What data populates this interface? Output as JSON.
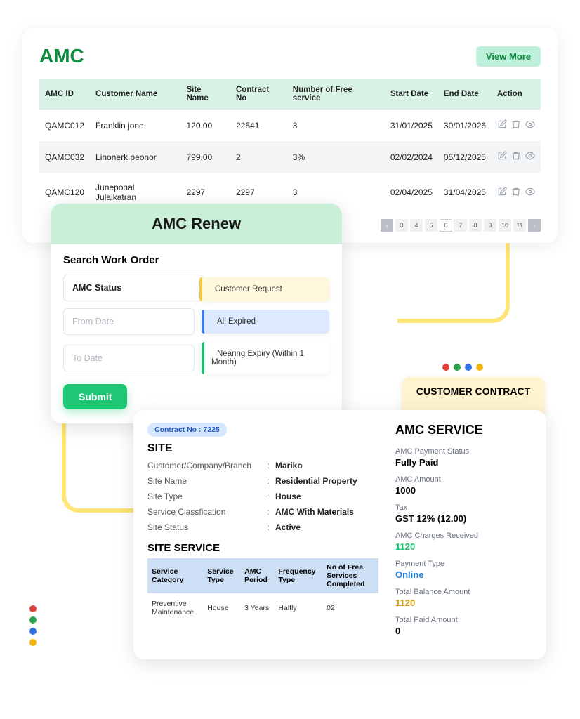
{
  "amc": {
    "title": "AMC",
    "view_more": "View More",
    "headers": [
      "AMC ID",
      "Customer Name",
      "Site Name",
      "Contract No",
      "Number of Free service",
      "Start Date",
      "End Date",
      "Action"
    ],
    "rows": [
      {
        "id": "QAMC012",
        "customer": "Franklin jone",
        "site": "120.00",
        "contract": "22541",
        "free": "3",
        "start": "31/01/2025",
        "end": "30/01/2026"
      },
      {
        "id": "QAMC032",
        "customer": "Linonerk peonor",
        "site": "799.00",
        "contract": "2",
        "free": "3%",
        "start": "02/02/2024",
        "end": "05/12/2025"
      },
      {
        "id": "QAMC120",
        "customer": "Juneponal Julaikatran",
        "site": "2297",
        "contract": "2297",
        "free": "3",
        "start": "02/04/2025",
        "end": "31/04/2025"
      }
    ],
    "pages": [
      "3",
      "4",
      "5",
      "6",
      "7",
      "8",
      "9",
      "10",
      "11"
    ],
    "active_page": "6"
  },
  "renew": {
    "title": "AMC Renew",
    "subtitle": "Search Work Order",
    "status_value": "AMC Status",
    "from_ph": "From Date",
    "to_ph": "To Date",
    "submit": "Submit",
    "chips": {
      "customer": "Customer Request",
      "expired": "All Expired",
      "nearing": "Nearing Expiry (Within 1 Month)"
    }
  },
  "contract_tab": "CUSTOMER CONTRACT",
  "detail": {
    "badge": "Contract No : 7225",
    "site_h": "SITE",
    "site": {
      "customer_l": "Customer/Company/Branch",
      "customer_v": "Mariko",
      "name_l": "Site Name",
      "name_v": "Residential Property",
      "type_l": "Site Type",
      "type_v": "House",
      "class_l": "Service Classfication",
      "class_v": "AMC With Materials",
      "status_l": "Site Status",
      "status_v": "Active"
    },
    "svc_h": "SITE SERVICE",
    "svc_headers": [
      "Service Category",
      "Service Type",
      "AMC Period",
      "Frequency Type",
      "No of Free Services Completed"
    ],
    "svc_row": {
      "cat": "Preventive Maintenance",
      "type": "House",
      "period": "3 Years",
      "freq": "Halfly",
      "free": "02"
    },
    "amc_svc_h": "AMC SERVICE",
    "stats": {
      "pay_status_l": "AMC Payment Status",
      "pay_status_v": "Fully Paid",
      "amount_l": "AMC Amount",
      "amount_v": "1000",
      "tax_l": "Tax",
      "tax_v": "GST 12% (12.00)",
      "recv_l": "AMC Charges Received",
      "recv_v": "1120",
      "ptype_l": "Payment Type",
      "ptype_v": "Online",
      "bal_l": "Total Balance Amount",
      "bal_v": "1120",
      "paid_l": "Total Paid Amount",
      "paid_v": "0"
    }
  }
}
